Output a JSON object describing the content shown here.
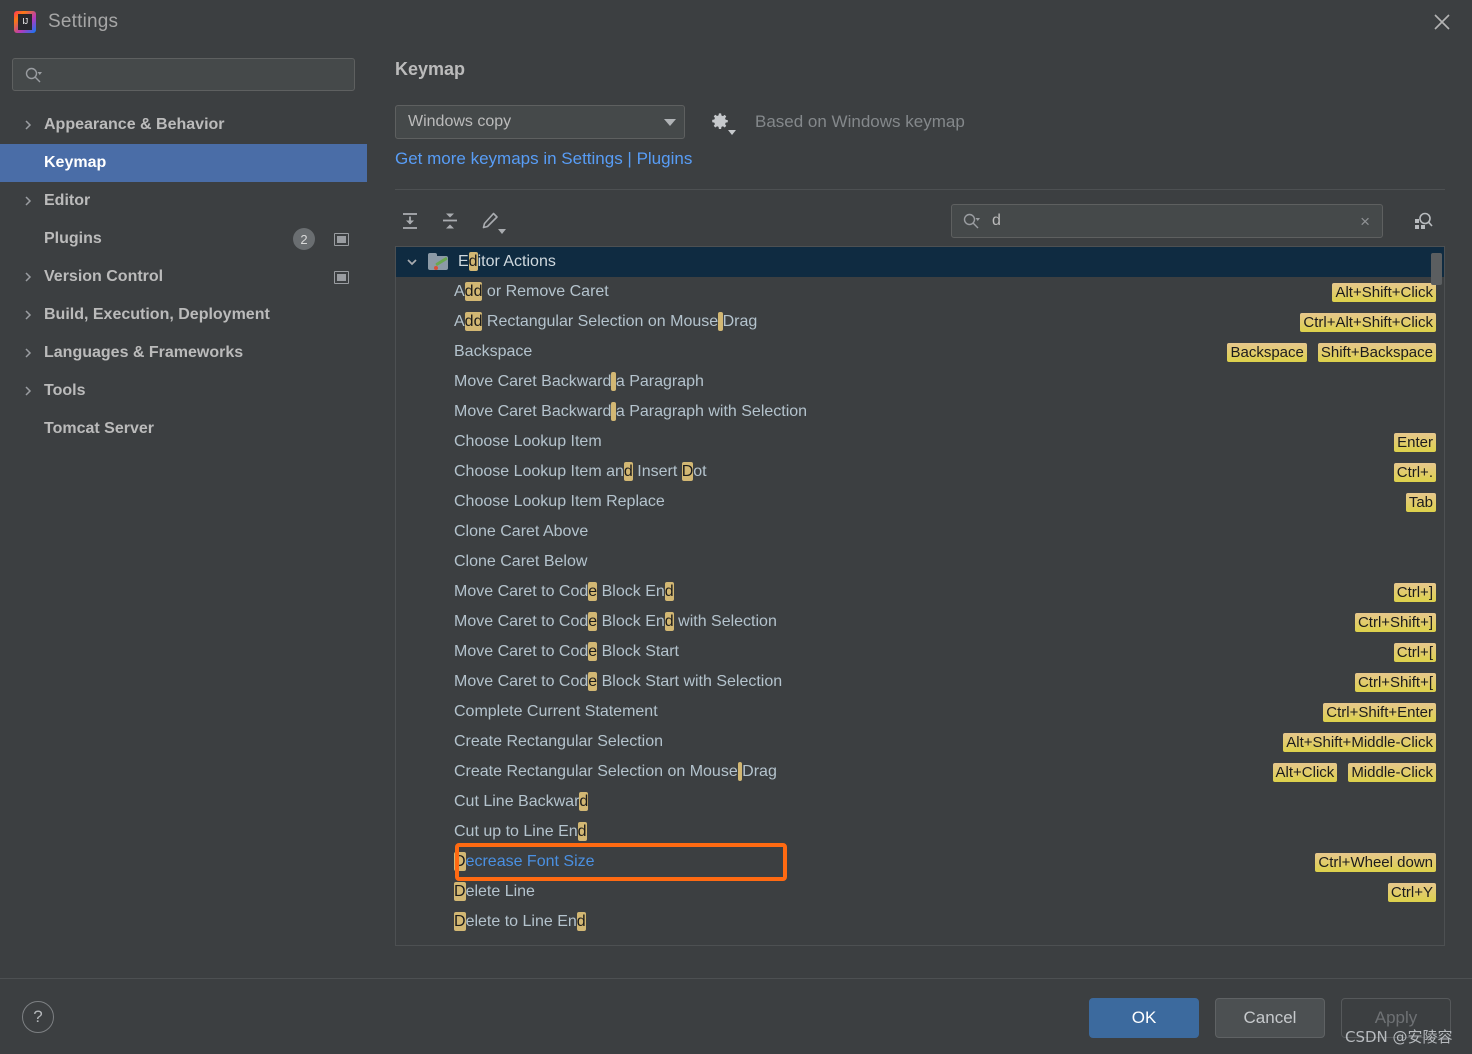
{
  "window": {
    "title": "Settings",
    "logo_text": "IJ",
    "close_icon": "close-icon"
  },
  "sidebar": {
    "search": {
      "value": "",
      "placeholder": ""
    },
    "items": [
      {
        "label": "Appearance & Behavior",
        "expandable": true,
        "selected": false
      },
      {
        "label": "Keymap",
        "expandable": false,
        "selected": true
      },
      {
        "label": "Editor",
        "expandable": true,
        "selected": false
      },
      {
        "label": "Plugins",
        "expandable": false,
        "selected": false,
        "badge": "2",
        "chip": true
      },
      {
        "label": "Version Control",
        "expandable": true,
        "selected": false,
        "chip": true
      },
      {
        "label": "Build, Execution, Deployment",
        "expandable": true,
        "selected": false
      },
      {
        "label": "Languages & Frameworks",
        "expandable": true,
        "selected": false
      },
      {
        "label": "Tools",
        "expandable": true,
        "selected": false
      },
      {
        "label": "Tomcat Server",
        "expandable": false,
        "selected": false
      }
    ]
  },
  "main": {
    "title": "Keymap",
    "keymap_select": {
      "value": "Windows copy"
    },
    "gear_label": "gear-icon",
    "based_on": "Based on Windows keymap",
    "plugins_link": "Get more keymaps in Settings | Plugins",
    "toolbar": {
      "expand_all": "expand-all-icon",
      "collapse_all": "collapse-all-icon",
      "edit_shortcut": "edit-pencil-icon"
    },
    "tree_search": {
      "value": "d",
      "clear_label": "×"
    },
    "find_by_shortcut": "find-by-shortcut-icon"
  },
  "tree": {
    "query": "d",
    "rows": [
      {
        "type": "group",
        "label": "Editor Actions",
        "hl": [
          [
            1,
            2
          ]
        ],
        "shortcuts": []
      },
      {
        "type": "action",
        "label": "Add or Remove Caret",
        "hl": [
          [
            1,
            3
          ]
        ],
        "shortcuts": [
          "Alt+Shift+Click"
        ]
      },
      {
        "type": "action",
        "label": "Add Rectangular Selection on Mouse Drag",
        "hl": [
          [
            1,
            3
          ],
          [
            34,
            35
          ]
        ],
        "shortcuts": [
          "Ctrl+Alt+Shift+Click"
        ]
      },
      {
        "type": "action",
        "label": "Backspace",
        "hl": [],
        "shortcuts": [
          "Backspace",
          "Shift+Backspace"
        ]
      },
      {
        "type": "action",
        "label": "Move Caret Backward a Paragraph",
        "hl": [
          [
            19,
            20
          ]
        ],
        "shortcuts": []
      },
      {
        "type": "action",
        "label": "Move Caret Backward a Paragraph with Selection",
        "hl": [
          [
            19,
            20
          ]
        ],
        "shortcuts": []
      },
      {
        "type": "action",
        "label": "Choose Lookup Item",
        "hl": [],
        "shortcuts": [
          "Enter"
        ]
      },
      {
        "type": "action",
        "label": "Choose Lookup Item and Insert Dot",
        "hl": [
          [
            21,
            22
          ],
          [
            30,
            31
          ]
        ],
        "shortcuts": [
          "Ctrl+."
        ]
      },
      {
        "type": "action",
        "label": "Choose Lookup Item Replace",
        "hl": [],
        "shortcuts": [
          "Tab"
        ]
      },
      {
        "type": "action",
        "label": "Clone Caret Above",
        "hl": [],
        "shortcuts": []
      },
      {
        "type": "action",
        "label": "Clone Caret Below",
        "hl": [],
        "shortcuts": []
      },
      {
        "type": "action",
        "label": "Move Caret to Code Block End",
        "hl": [
          [
            17,
            18
          ],
          [
            27,
            28
          ]
        ],
        "shortcuts": [
          "Ctrl+]"
        ]
      },
      {
        "type": "action",
        "label": "Move Caret to Code Block End with Selection",
        "hl": [
          [
            17,
            18
          ],
          [
            27,
            28
          ]
        ],
        "shortcuts": [
          "Ctrl+Shift+]"
        ]
      },
      {
        "type": "action",
        "label": "Move Caret to Code Block Start",
        "hl": [
          [
            17,
            18
          ]
        ],
        "shortcuts": [
          "Ctrl+["
        ]
      },
      {
        "type": "action",
        "label": "Move Caret to Code Block Start with Selection",
        "hl": [
          [
            17,
            18
          ]
        ],
        "shortcuts": [
          "Ctrl+Shift+["
        ]
      },
      {
        "type": "action",
        "label": "Complete Current Statement",
        "hl": [],
        "shortcuts": [
          "Ctrl+Shift+Enter"
        ]
      },
      {
        "type": "action",
        "label": "Create Rectangular Selection",
        "hl": [],
        "shortcuts": [
          "Alt+Shift+Middle-Click"
        ]
      },
      {
        "type": "action",
        "label": "Create Rectangular Selection on Mouse Drag",
        "hl": [
          [
            37,
            38
          ]
        ],
        "shortcuts": [
          "Alt+Click",
          "Middle-Click"
        ]
      },
      {
        "type": "action",
        "label": "Cut Line Backward",
        "hl": [
          [
            16,
            17
          ]
        ],
        "shortcuts": []
      },
      {
        "type": "action",
        "label": "Cut up to Line End",
        "hl": [
          [
            17,
            18
          ]
        ],
        "shortcuts": []
      },
      {
        "type": "action",
        "label": "Decrease Font Size",
        "hl": [
          [
            0,
            1
          ]
        ],
        "shortcuts": [
          "Ctrl+Wheel down"
        ],
        "accent": true
      },
      {
        "type": "action",
        "label": "Delete Line",
        "hl": [
          [
            0,
            1
          ]
        ],
        "shortcuts": [
          "Ctrl+Y"
        ]
      },
      {
        "type": "action",
        "label": "Delete to Line End",
        "hl": [
          [
            0,
            1
          ],
          [
            17,
            18
          ]
        ],
        "shortcuts": []
      }
    ],
    "annotation": {
      "target_label": "Decrease Font Size",
      "color": "#ff6a12"
    }
  },
  "footer": {
    "help_label": "?",
    "ok_label": "OK",
    "cancel_label": "Cancel",
    "apply_label": "Apply",
    "watermark": "CSDN @安陵容"
  },
  "colors": {
    "accent_selection": "#4a6da7",
    "group_row": "#0f2b41",
    "link": "#589df6",
    "shortcut_chip": "#dcd14a",
    "annotation": "#ff6a12",
    "action_accent": "#4a90e2"
  }
}
